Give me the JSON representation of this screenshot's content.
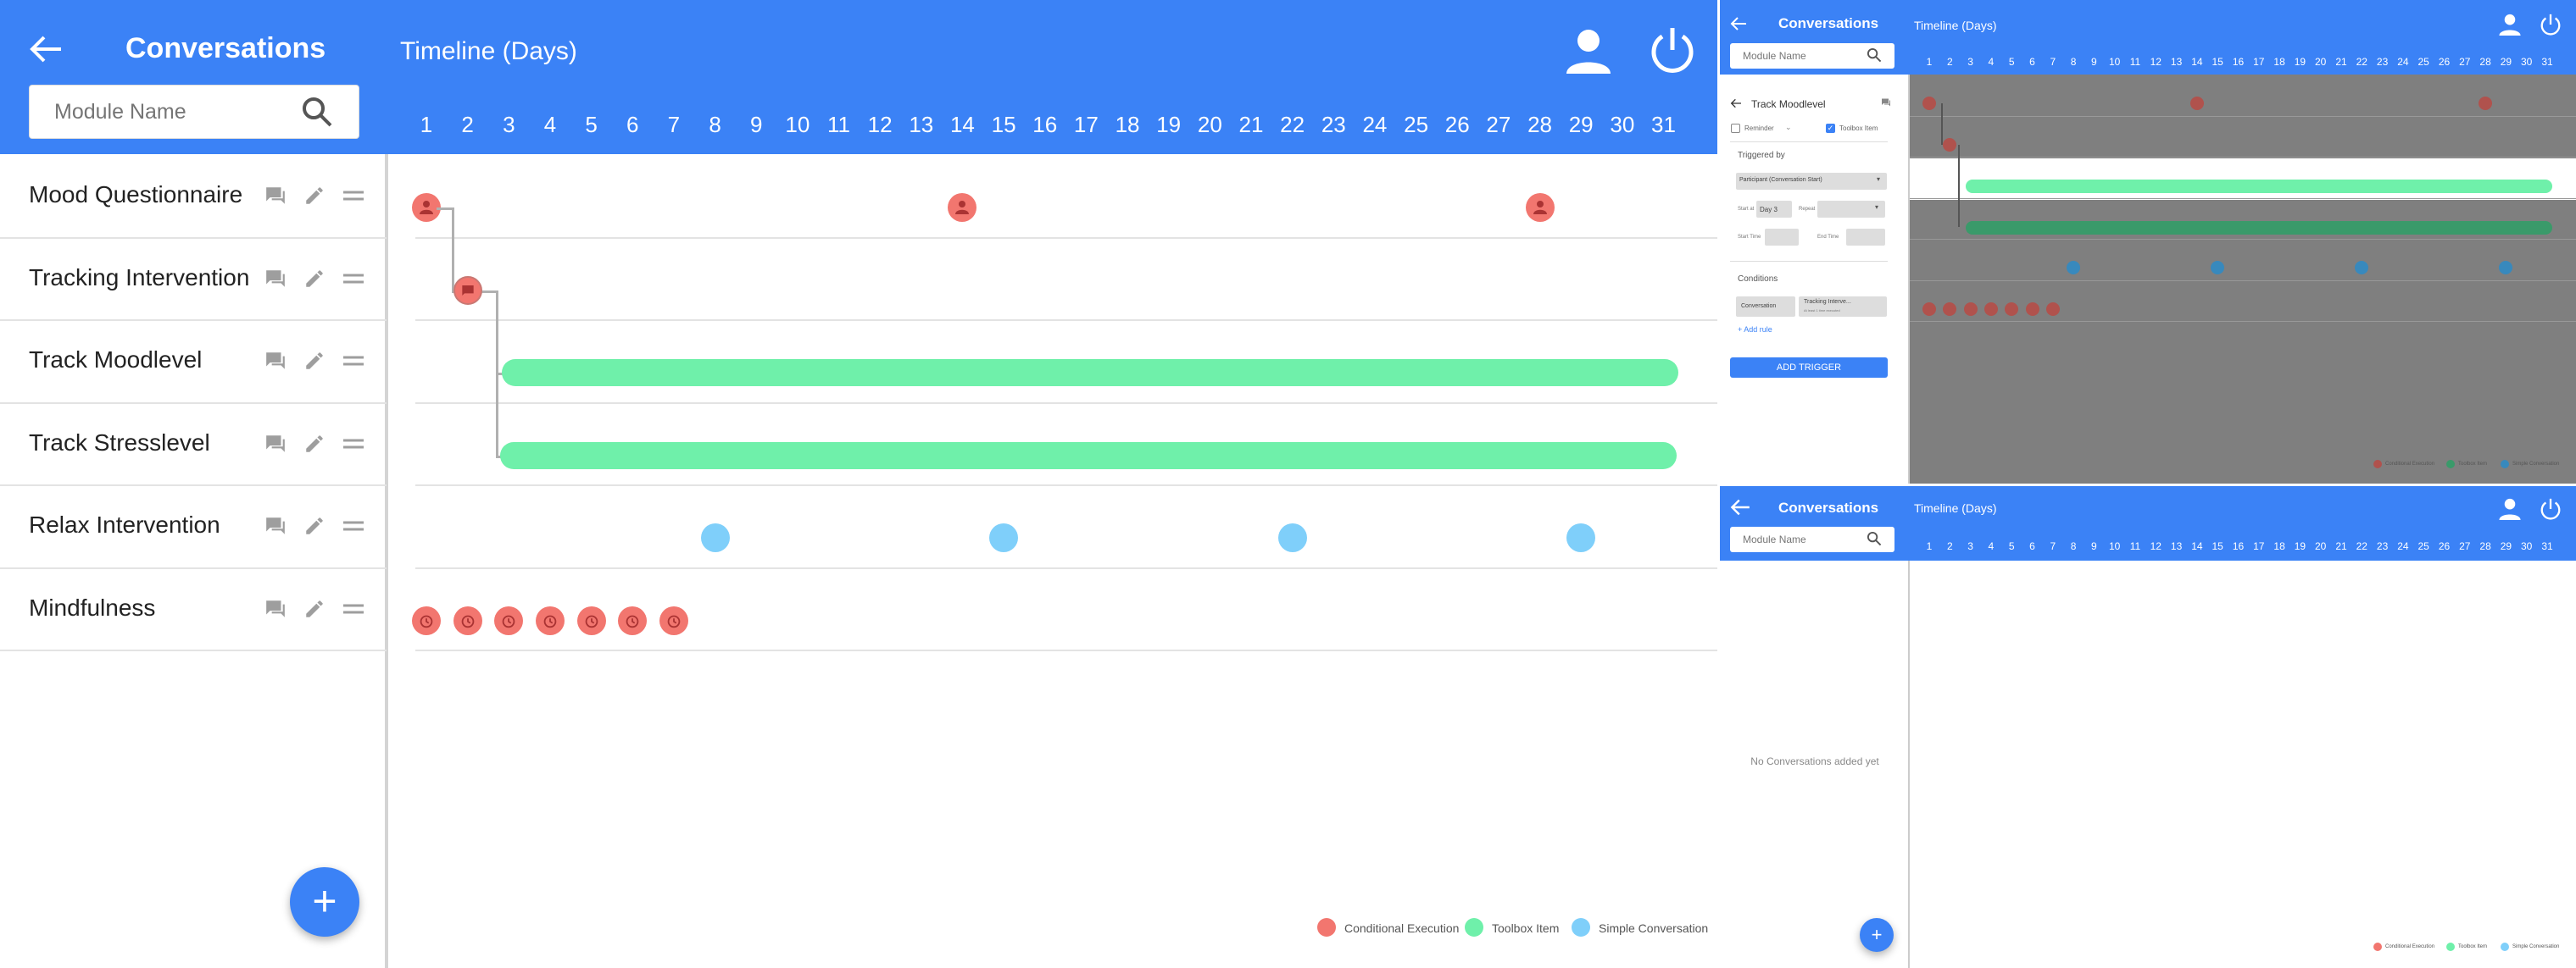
{
  "main": {
    "header": {
      "title": "Conversations",
      "timeline_title": "Timeline (Days)",
      "search_placeholder": "Module Name"
    },
    "days": [
      "1",
      "2",
      "3",
      "4",
      "5",
      "6",
      "7",
      "8",
      "9",
      "10",
      "11",
      "12",
      "13",
      "14",
      "15",
      "16",
      "17",
      "18",
      "19",
      "20",
      "21",
      "22",
      "23",
      "24",
      "25",
      "26",
      "27",
      "28",
      "29",
      "30",
      "31"
    ],
    "modules": [
      {
        "label": "Mood Questionnaire"
      },
      {
        "label": "Tracking Intervention"
      },
      {
        "label": "Track Moodlevel"
      },
      {
        "label": "Track Stresslevel"
      },
      {
        "label": "Relax Intervention"
      },
      {
        "label": "Mindfulness"
      }
    ],
    "legend": [
      {
        "label": "Conditional Execution",
        "color": "#f2766f"
      },
      {
        "label": "Toolbox Item",
        "color": "#6ff0aa"
      },
      {
        "label": "Simple Conversation",
        "color": "#7fcffa"
      }
    ],
    "fab_label": "+"
  },
  "edit_panel": {
    "header_title": "Conversations",
    "timeline_title": "Timeline (Days)",
    "search_placeholder": "Module Name",
    "module_title": "Track Moodlevel",
    "reminder_label": "Reminder",
    "toolbox_label": "Toolbox Item",
    "triggered_by_label": "Triggered by",
    "trigger_select_value": "Participant (Conversation Start)",
    "start_at_label": "Start at",
    "start_at_value": "Day 3",
    "repeat_label": "Repeat",
    "start_time_label": "Start Time",
    "end_time_label": "End Time",
    "conditions_label": "Conditions",
    "condition_type": "Conversation",
    "condition_value": "Tracking Interve...",
    "condition_sub": "At least 1 time executed",
    "add_rule": "+ Add rule",
    "add_trigger": "ADD TRIGGER",
    "legend": [
      "Conditional Execution",
      "Toolbox Item",
      "Simple Conversation"
    ]
  },
  "empty_panel": {
    "header_title": "Conversations",
    "timeline_title": "Timeline (Days)",
    "search_placeholder": "Module Name",
    "empty_text": "No Conversations added yet",
    "fab_label": "+",
    "legend": [
      "Conditional Execution",
      "Toolbox Item",
      "Simple Conversation"
    ]
  },
  "colors": {
    "primary": "#3b82f6",
    "conditional": "#f2766f",
    "toolbox": "#6ff0aa",
    "simple": "#7fcffa"
  }
}
